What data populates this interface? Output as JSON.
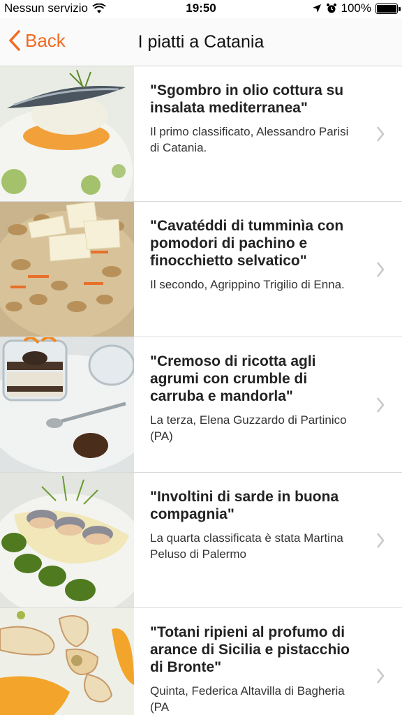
{
  "status_bar": {
    "carrier": "Nessun servizio",
    "time": "19:50",
    "battery": "100%",
    "icons": [
      "wifi-icon",
      "location-arrow-icon",
      "alarm-icon",
      "battery-icon"
    ]
  },
  "nav": {
    "back_label": "Back",
    "title": "I piatti a Catania"
  },
  "colors": {
    "accent": "#f06a21",
    "separator": "#d8d8d8",
    "chevron": "#c7c7cc"
  },
  "dishes": [
    {
      "title": "\"Sgombro in olio cottura su insalata mediterranea\"",
      "subtitle": "Il primo classificato, Alessandro Parisi di Catania."
    },
    {
      "title": "\"Cavatéddi di tumminìa con pomodori di pachino e finocchietto selvatico\"",
      "subtitle": "Il secondo, Agrippino Trigilio di Enna."
    },
    {
      "title": "\"Cremoso di ricotta agli agrumi con crumble di carruba e mandorla\"",
      "subtitle": "La terza, Elena Guzzardo di Partinico (PA)"
    },
    {
      "title": "\"Involtini di sarde in buona compagnia\"",
      "subtitle": "La quarta classificata è stata Martina Peluso di Palermo"
    },
    {
      "title": "\"Totani ripieni al profumo di arance di Sicilia e pistacchio di Bronte\"",
      "subtitle": "Quinta, Federica Altavilla di Bagheria (PA"
    }
  ]
}
